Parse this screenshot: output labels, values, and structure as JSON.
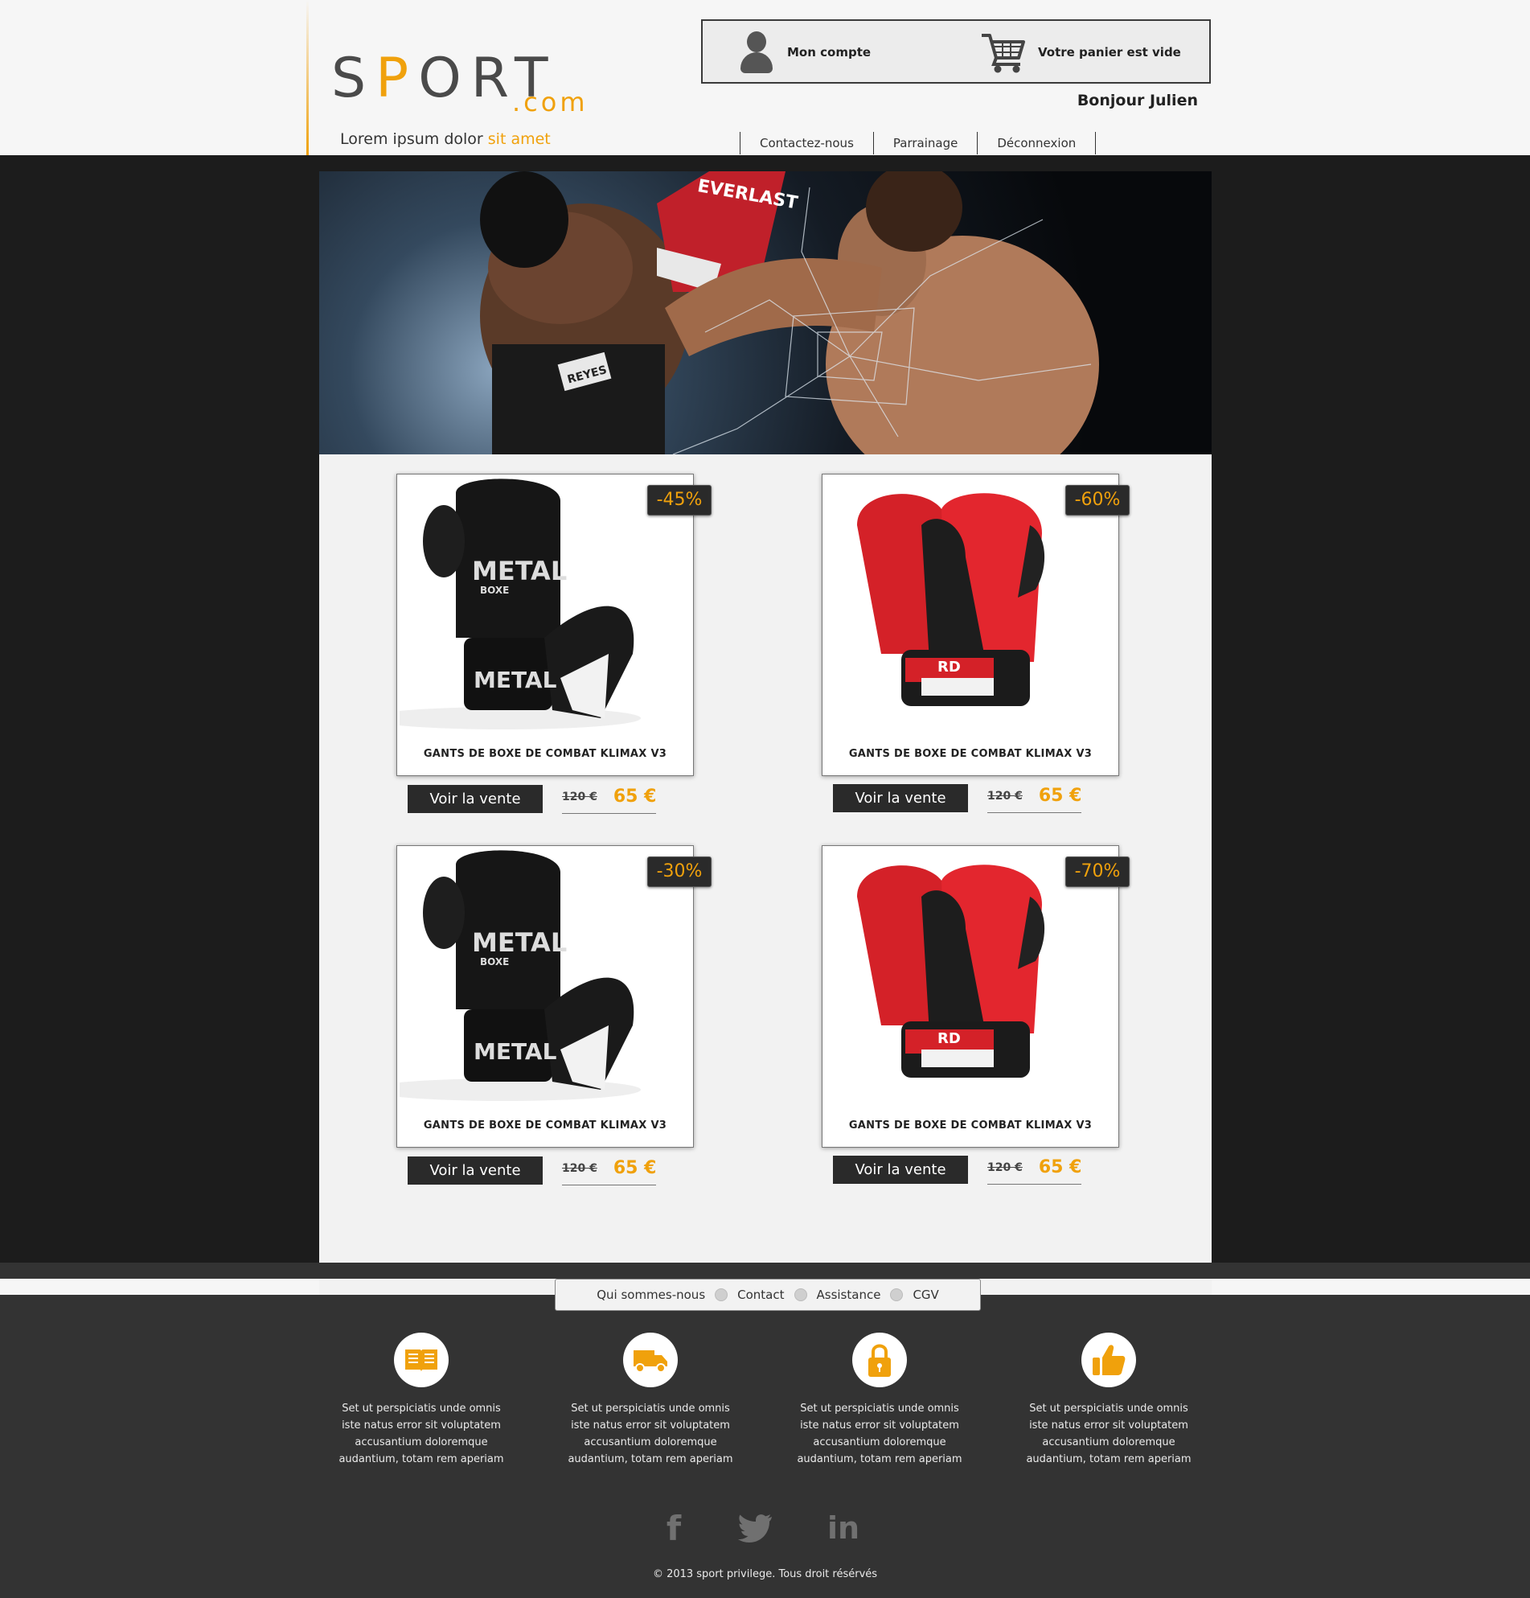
{
  "header": {
    "logo_text_pre": "S",
    "logo_text_p": "P",
    "logo_text_post": "ORT",
    "logo_domain": ".com",
    "tagline_plain": "Lorem ipsum dolor ",
    "tagline_accent": "sit amet",
    "account_label": "Mon compte",
    "cart_label": "Votre panier est vide",
    "greeting": "Bonjour Julien",
    "nav": [
      "Contactez-nous",
      "Parrainage",
      "Déconnexion"
    ]
  },
  "products": [
    {
      "name": "GANTS DE BOXE DE COMBAT KLIMAX V3",
      "discount": "-45%",
      "button": "Voir la vente",
      "old_price": "120 €",
      "new_price": "65 €",
      "glove_color": "black"
    },
    {
      "name": "GANTS DE BOXE DE COMBAT KLIMAX V3",
      "discount": "-60%",
      "button": "Voir la vente",
      "old_price": "120 €",
      "new_price": "65 €",
      "glove_color": "red"
    },
    {
      "name": "GANTS DE BOXE DE COMBAT KLIMAX V3",
      "discount": "-30%",
      "button": "Voir la vente",
      "old_price": "120 €",
      "new_price": "65 €",
      "glove_color": "black"
    },
    {
      "name": "GANTS DE BOXE DE COMBAT KLIMAX V3",
      "discount": "-70%",
      "button": "Voir la vente",
      "old_price": "120 €",
      "new_price": "65 €",
      "glove_color": "red"
    }
  ],
  "glove_labels": {
    "black_top": "METAL",
    "black_sub": "BOXE",
    "red_logo": "RD"
  },
  "hero_labels": {
    "glove_brand": "EVERLAST",
    "shorts_brand": "REYES"
  },
  "footer": {
    "nav": [
      "Qui sommes-nous",
      "Contact",
      "Assistance",
      "CGV"
    ],
    "features": [
      {
        "icon": "book-icon",
        "text": "Set ut perspiciatis unde omnis iste natus error sit voluptatem accusantium doloremque audantium, totam rem aperiam"
      },
      {
        "icon": "truck-icon",
        "text": "Set ut perspiciatis unde omnis iste natus error sit voluptatem accusantium doloremque audantium, totam rem aperiam"
      },
      {
        "icon": "lock-icon",
        "text": "Set ut perspiciatis unde omnis iste natus error sit voluptatem accusantium doloremque audantium, totam rem aperiam"
      },
      {
        "icon": "thumbs-up-icon",
        "text": "Set ut perspiciatis unde omnis iste natus error sit voluptatem accusantium doloremque audantium, totam rem aperiam"
      }
    ],
    "social": [
      {
        "icon": "facebook-icon",
        "glyph": "f"
      },
      {
        "icon": "twitter-icon",
        "glyph": ""
      },
      {
        "icon": "linkedin-icon",
        "glyph": "in"
      }
    ],
    "copyright": "© 2013 sport privilege. Tous droit résérvés"
  },
  "colors": {
    "accent": "#f0a10c",
    "dark": "#1c1c1c",
    "footer": "#333333",
    "light": "#f2f2f2"
  }
}
